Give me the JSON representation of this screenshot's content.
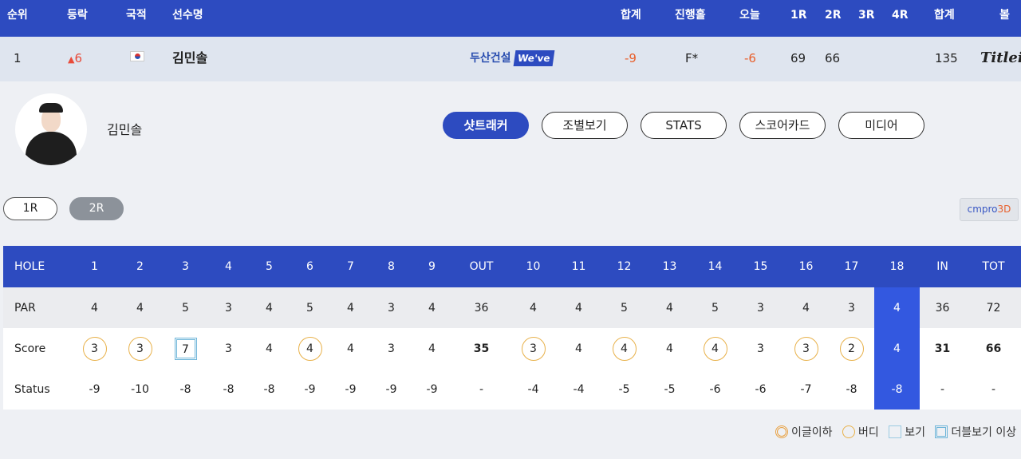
{
  "header": {
    "rank": "순위",
    "change": "등락",
    "nation": "국적",
    "name": "선수명",
    "total": "합계",
    "progress": "진행홀",
    "today": "오늘",
    "r1": "1R",
    "r2": "2R",
    "r3": "3R",
    "r4": "4R",
    "sum": "합계",
    "ball": "볼"
  },
  "player_row": {
    "rank": "1",
    "change": "6",
    "name": "김민솔",
    "sponsor": "두산건설",
    "sponsor_logo": "We've",
    "total": "-9",
    "progress": "F*",
    "today": "-6",
    "r1": "69",
    "r2": "66",
    "r3": "",
    "r4": "",
    "sum": "135",
    "ball": "Titleist"
  },
  "profile": {
    "name": "김민솔",
    "tabs": [
      "샷트래커",
      "조별보기",
      "STATS",
      "스코어카드",
      "미디어"
    ],
    "active_tab": 0
  },
  "rounds": {
    "buttons": [
      "1R",
      "2R"
    ],
    "selected": "2R"
  },
  "cmpro": {
    "label": "cmpro",
    "label_3d": "3D"
  },
  "scorecard": {
    "head": [
      "HOLE",
      "1",
      "2",
      "3",
      "4",
      "5",
      "6",
      "7",
      "8",
      "9",
      "OUT",
      "10",
      "11",
      "12",
      "13",
      "14",
      "15",
      "16",
      "17",
      "18",
      "IN",
      "TOT"
    ],
    "par": [
      "PAR",
      "4",
      "4",
      "5",
      "3",
      "4",
      "5",
      "4",
      "3",
      "4",
      "36",
      "4",
      "4",
      "5",
      "4",
      "5",
      "3",
      "4",
      "3",
      "4",
      "36",
      "72"
    ],
    "score": [
      "Score",
      "3",
      "3",
      "7",
      "3",
      "4",
      "4",
      "4",
      "3",
      "4",
      "35",
      "3",
      "4",
      "4",
      "4",
      "4",
      "3",
      "3",
      "2",
      "4",
      "31",
      "66"
    ],
    "score_marks": [
      "",
      "birdie",
      "birdie",
      "double-bogey",
      "",
      "",
      "birdie",
      "",
      "",
      "",
      "",
      "birdie",
      "",
      "birdie",
      "",
      "birdie",
      "",
      "birdie",
      "birdie",
      "",
      "",
      ""
    ],
    "status": [
      "Status",
      "-9",
      "-10",
      "-8",
      "-8",
      "-8",
      "-9",
      "-9",
      "-9",
      "-9",
      "-",
      "-4",
      "-4",
      "-5",
      "-5",
      "-6",
      "-6",
      "-7",
      "-8",
      "-8",
      "-",
      "-"
    ],
    "highlight_hole": "18"
  },
  "legend": {
    "eagle": "이글이하",
    "birdie": "버디",
    "bogey": "보기",
    "double_bogey": "더블보기 이상"
  },
  "colors": {
    "header_bg": "#2d4bc0",
    "highlight": "#3358e0",
    "birdie": "#e8b14a",
    "bogey": "#6cb4d8"
  }
}
